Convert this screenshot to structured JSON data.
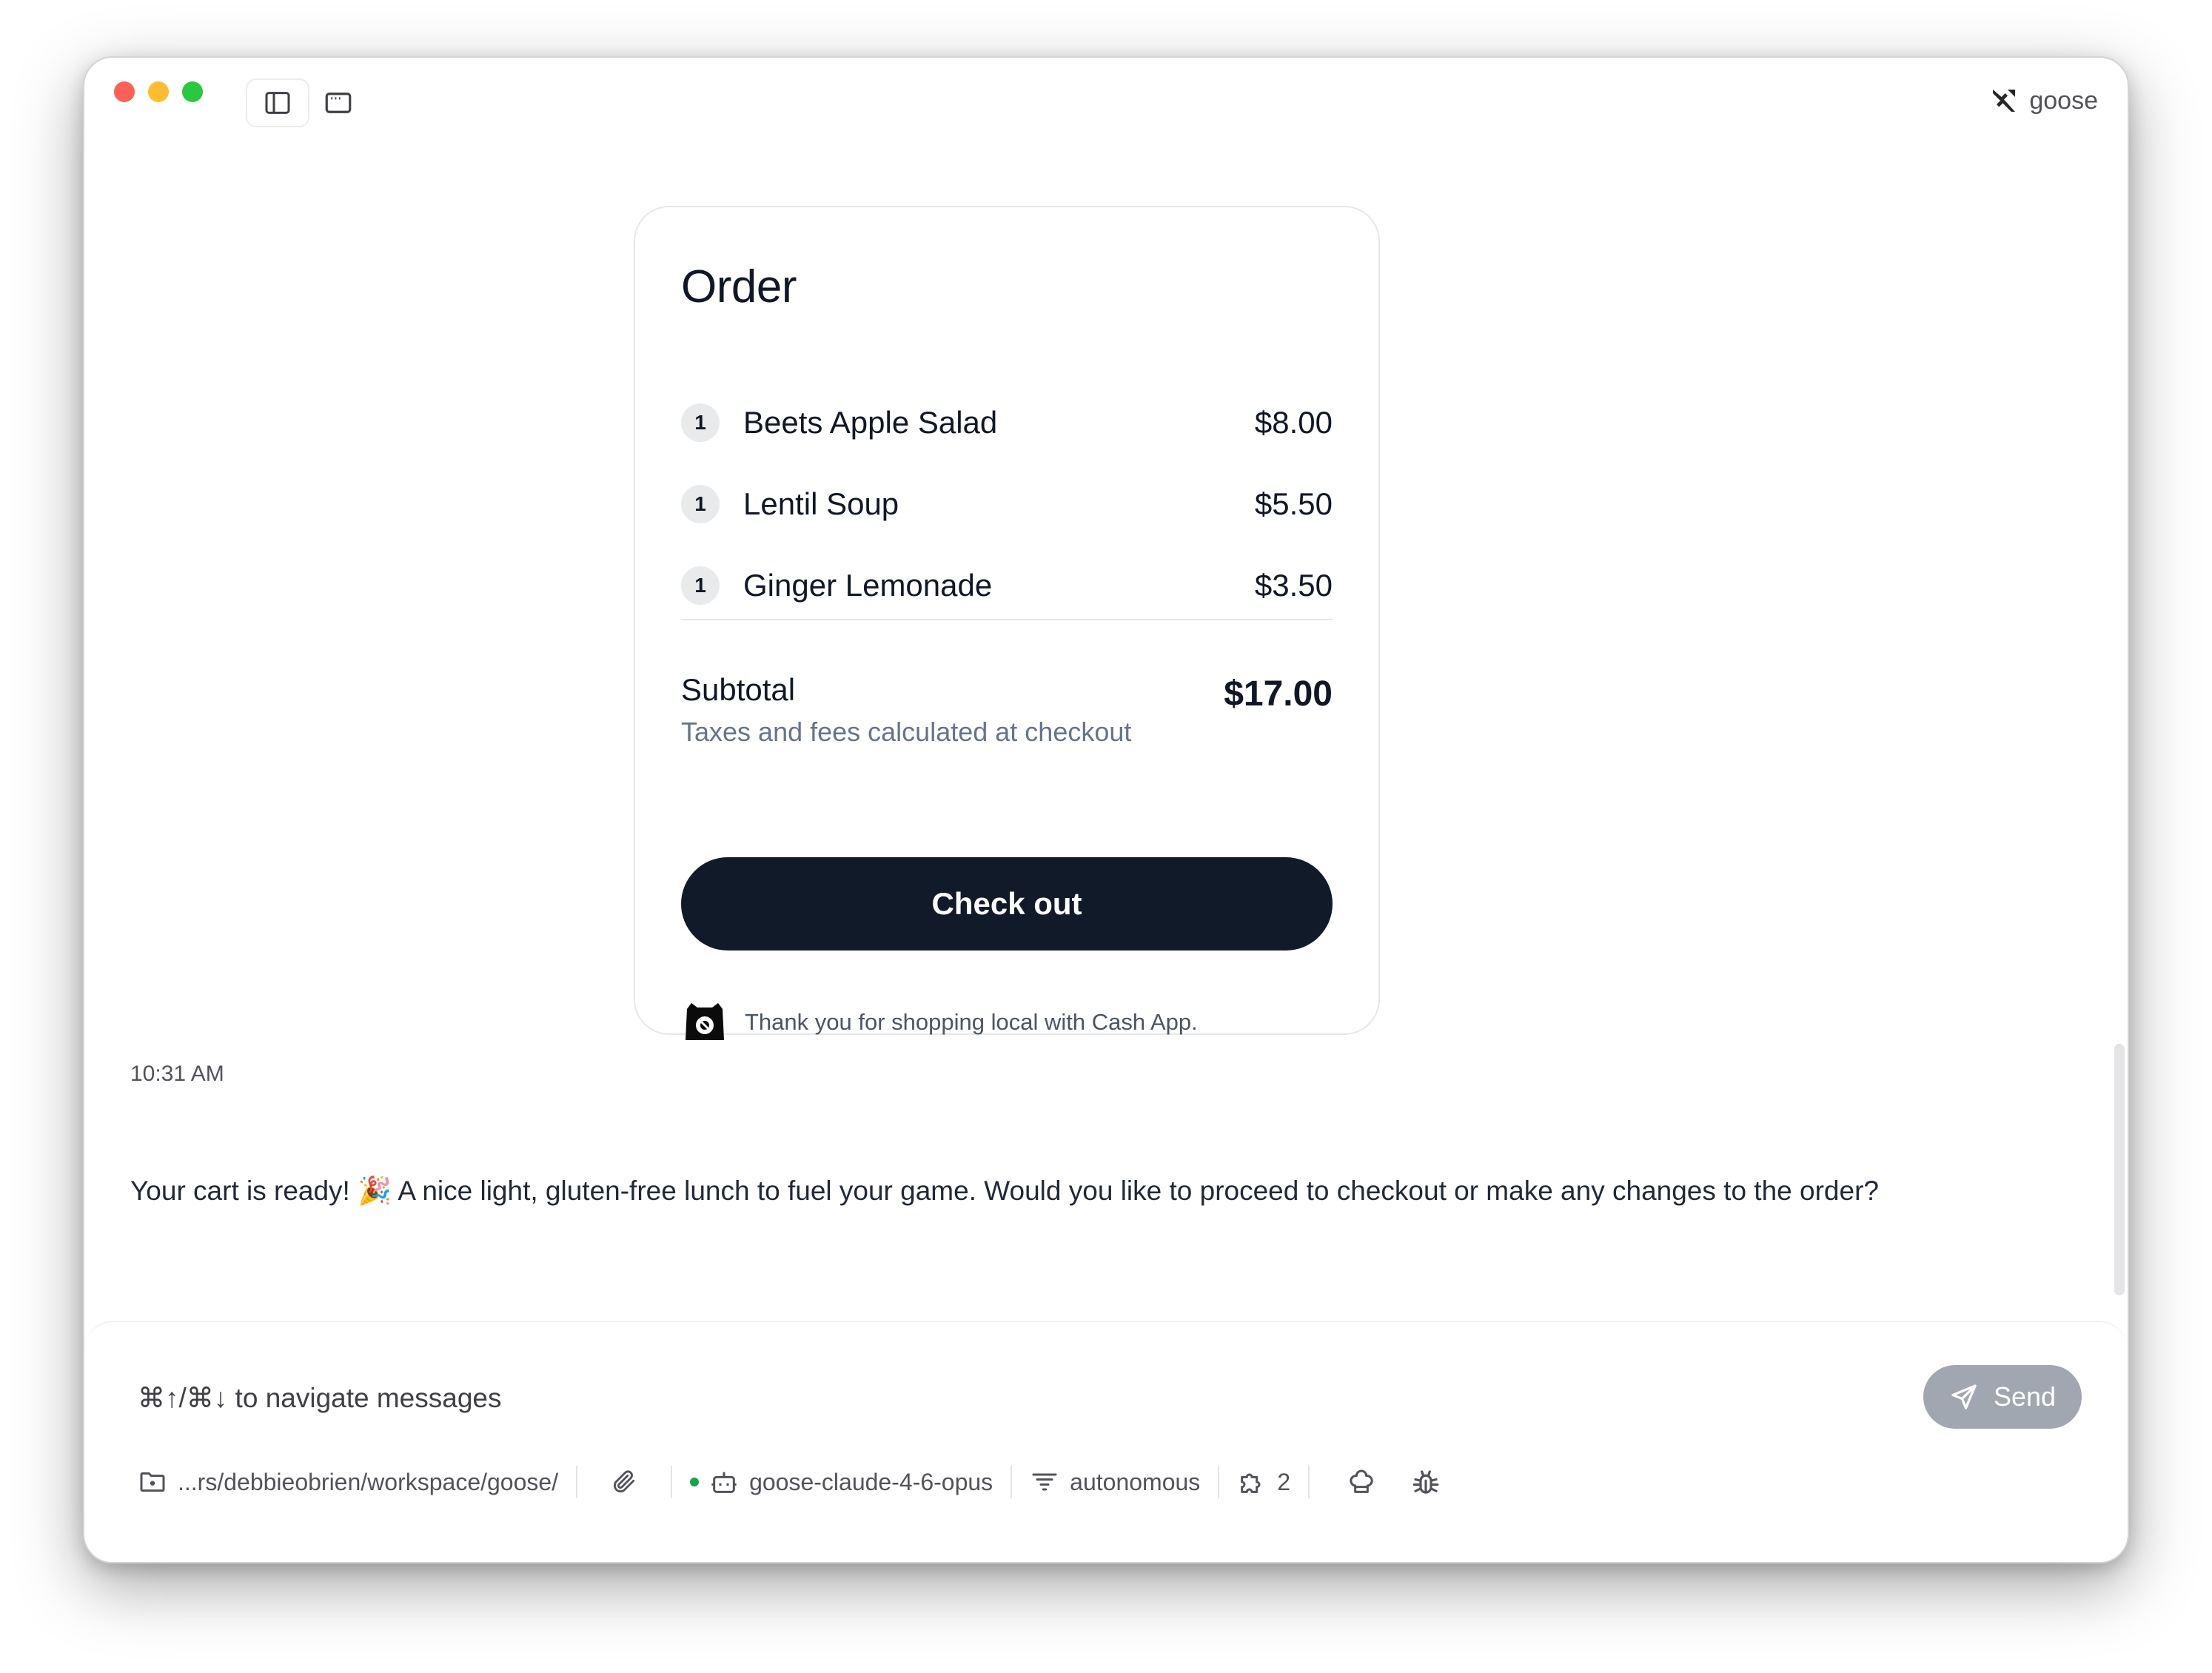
{
  "app": {
    "name": "goose"
  },
  "order": {
    "title": "Order",
    "items": [
      {
        "qty": "1",
        "name": "Beets Apple Salad",
        "price": "$8.00"
      },
      {
        "qty": "1",
        "name": "Lentil Soup",
        "price": "$5.50"
      },
      {
        "qty": "1",
        "name": "Ginger Lemonade",
        "price": "$3.50"
      }
    ],
    "subtotal_label": "Subtotal",
    "subtotal_note": "Taxes and fees calculated at checkout",
    "subtotal_value": "$17.00",
    "checkout_label": "Check out",
    "thanks_text": "Thank you for shopping local with Cash App."
  },
  "chat": {
    "timestamp": "10:31 AM",
    "message": "Your cart is ready! 🎉 A nice light, gluten-free lunch to fuel your game. Would you like to proceed to checkout or make any changes to the order?"
  },
  "composer": {
    "placeholder": "⌘↑/⌘↓ to navigate messages",
    "send_label": "Send"
  },
  "toolbar": {
    "directory": "...rs/debbieobrien/workspace/goose/",
    "model": "goose-claude-4-6-opus",
    "mode": "autonomous",
    "extensions_count": "2"
  },
  "colors": {
    "status_dot": "#16a34a",
    "checkout_button": "#111a28",
    "send_button": "#a1a7b0"
  },
  "icons": [
    "sidebar-toggle-icon",
    "new-window-icon",
    "goose-logo-icon",
    "cash-app-logo-icon",
    "send-icon",
    "folder-icon",
    "paperclip-icon",
    "bot-icon",
    "filter-icon",
    "puzzle-icon",
    "chef-hat-icon",
    "bug-icon"
  ]
}
